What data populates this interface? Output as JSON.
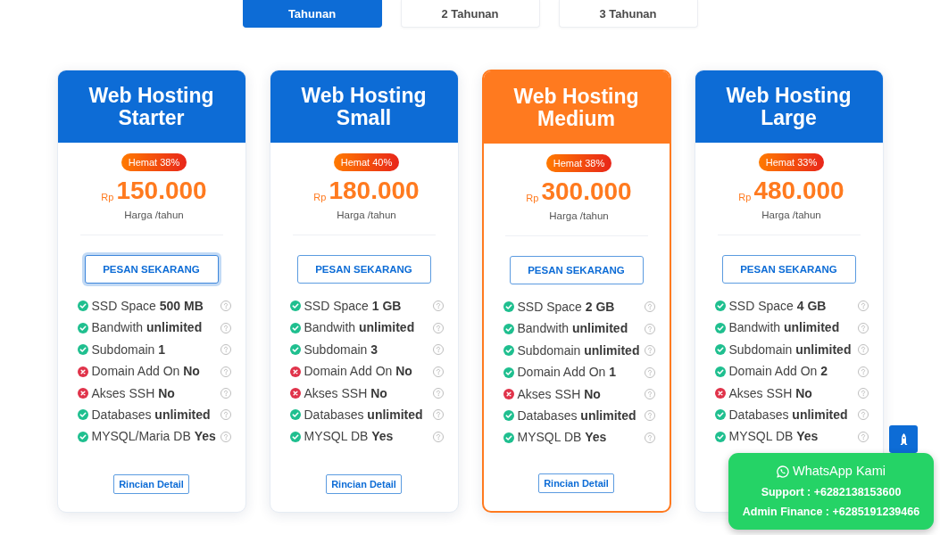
{
  "period_tabs": [
    {
      "label": "Tahunan",
      "selected": true
    },
    {
      "label": "2 Tahunan",
      "selected": false
    },
    {
      "label": "3 Tahunan",
      "selected": false
    }
  ],
  "plans": [
    {
      "title": "Web Hosting Starter",
      "featured": false,
      "discount": "Hemat 38%",
      "currency": "Rp",
      "price": "150.000",
      "period": "Harga /tahun",
      "order_button": {
        "label": "PESAN SEKARANG",
        "focused": true
      },
      "features": [
        {
          "text": "SSD Space **500 MB**",
          "included": true
        },
        {
          "text": "Bandwith **unlimited**",
          "included": true
        },
        {
          "text": "Subdomain **1**",
          "included": true
        },
        {
          "text": "Domain Add On **No**",
          "included": false
        },
        {
          "text": "Akses SSH **No**",
          "included": false
        },
        {
          "text": "Databases **unlimited**",
          "included": true
        },
        {
          "text": "MYSQL/Maria DB **Yes**",
          "included": true
        }
      ],
      "detail_button": "Rincian Detail"
    },
    {
      "title": "Web Hosting Small",
      "featured": false,
      "discount": "Hemat 40%",
      "currency": "Rp",
      "price": "180.000",
      "period": "Harga /tahun",
      "order_button": {
        "label": "PESAN SEKARANG",
        "focused": false
      },
      "features": [
        {
          "text": "SSD Space **1 GB**",
          "included": true
        },
        {
          "text": "Bandwith **unlimited**",
          "included": true
        },
        {
          "text": "Subdomain **3**",
          "included": true
        },
        {
          "text": "Domain Add On **No**",
          "included": false
        },
        {
          "text": "Akses SSH **No**",
          "included": false
        },
        {
          "text": "Databases **unlimited**",
          "included": true
        },
        {
          "text": "MYSQL DB **Yes**",
          "included": true
        }
      ],
      "detail_button": "Rincian Detail"
    },
    {
      "title": "Web Hosting Medium",
      "featured": true,
      "discount": "Hemat 38%",
      "currency": "Rp",
      "price": "300.000",
      "period": "Harga /tahun",
      "order_button": {
        "label": "PESAN SEKARANG",
        "focused": false
      },
      "features": [
        {
          "text": "SSD Space **2 GB**",
          "included": true
        },
        {
          "text": "Bandwith **unlimited**",
          "included": true
        },
        {
          "text": "Subdomain **unlimited**",
          "included": true
        },
        {
          "text": "Domain Add On **1**",
          "included": true
        },
        {
          "text": "Akses SSH **No**",
          "included": false
        },
        {
          "text": "Databases **unlimited**",
          "included": true
        },
        {
          "text": "MYSQL DB **Yes**",
          "included": true
        }
      ],
      "detail_button": "Rincian Detail"
    },
    {
      "title": "Web Hosting Large",
      "featured": false,
      "discount": "Hemat 33%",
      "currency": "Rp",
      "price": "480.000",
      "period": "Harga /tahun",
      "order_button": {
        "label": "PESAN SEKARANG",
        "focused": false
      },
      "features": [
        {
          "text": "SSD Space **4 GB**",
          "included": true
        },
        {
          "text": "Bandwith **unlimited**",
          "included": true
        },
        {
          "text": "Subdomain **unlimited**",
          "included": true
        },
        {
          "text": "Domain Add On **2**",
          "included": true
        },
        {
          "text": "Akses SSH **No**",
          "included": false
        },
        {
          "text": "Databases **unlimited**",
          "included": true
        },
        {
          "text": "MYSQL DB **Yes**",
          "included": true
        }
      ]
    }
  ],
  "whatsapp": {
    "title": "WhatsApp Kami",
    "lines": [
      "Support : +6282138153600",
      "Admin Finance : +6285191239466"
    ]
  }
}
